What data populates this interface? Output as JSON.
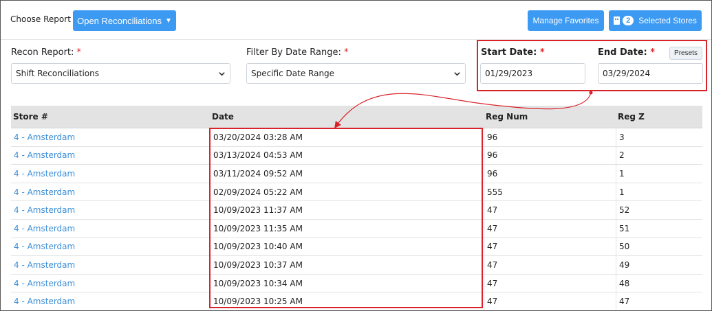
{
  "header": {
    "choose_report_label": "Choose Report",
    "open_button_label": "Open Reconciliations",
    "manage_favorites_label": "Manage Favorites",
    "selected_stores_count": "2",
    "selected_stores_label": "Selected Stores"
  },
  "filters": {
    "recon_report_label": "Recon Report:",
    "recon_report_value": "Shift Reconciliations",
    "date_range_label": "Filter By Date Range:",
    "date_range_value": "Specific Date Range",
    "start_date_label": "Start Date:",
    "start_date_value": "01/29/2023",
    "end_date_label": "End Date:",
    "end_date_value": "03/29/2024",
    "presets_label": "Presets",
    "required_mark": "*"
  },
  "table": {
    "columns": [
      "Store #",
      "Date",
      "Reg Num",
      "Reg Z"
    ],
    "rows": [
      [
        "4 - Amsterdam",
        "03/20/2024 03:28 AM",
        "96",
        "3"
      ],
      [
        "4 - Amsterdam",
        "03/13/2024 04:53 AM",
        "96",
        "2"
      ],
      [
        "4 - Amsterdam",
        "03/11/2024 09:52 AM",
        "96",
        "1"
      ],
      [
        "4 - Amsterdam",
        "02/09/2024 05:22 AM",
        "555",
        "1"
      ],
      [
        "4 - Amsterdam",
        "10/09/2023 11:37 AM",
        "47",
        "52"
      ],
      [
        "4 - Amsterdam",
        "10/09/2023 11:35 AM",
        "47",
        "51"
      ],
      [
        "4 - Amsterdam",
        "10/09/2023 10:40 AM",
        "47",
        "50"
      ],
      [
        "4 - Amsterdam",
        "10/09/2023 10:37 AM",
        "47",
        "49"
      ],
      [
        "4 - Amsterdam",
        "10/09/2023 10:34 AM",
        "47",
        "48"
      ],
      [
        "4 - Amsterdam",
        "10/09/2023 10:25 AM",
        "47",
        "47"
      ]
    ]
  },
  "colors": {
    "primary_button": "#3d9af2",
    "link": "#3d8fd8",
    "annotation": "#d9232a",
    "required": "#e02424"
  }
}
